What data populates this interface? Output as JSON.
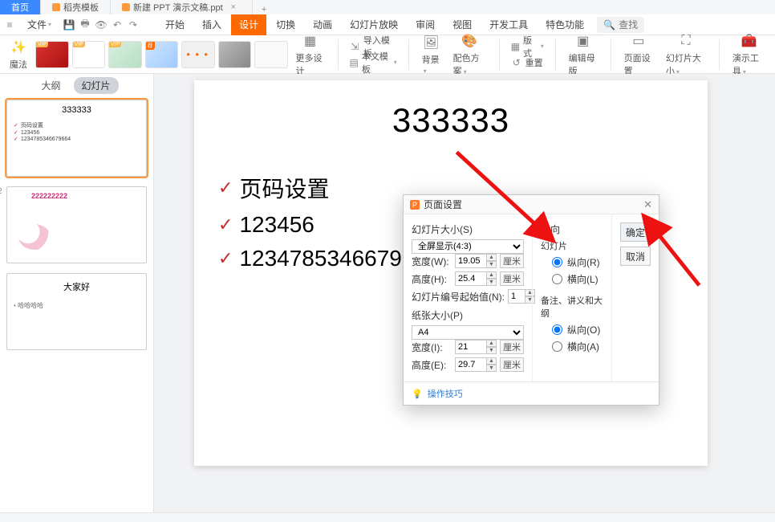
{
  "tabs": {
    "home": "首页",
    "templates": "稻壳模板",
    "doc": "新建 PPT 演示文稿.ppt",
    "add": "+"
  },
  "menu": {
    "file": "文件",
    "items": [
      "开始",
      "插入",
      "设计",
      "切换",
      "动画",
      "幻灯片放映",
      "审阅",
      "视图",
      "开发工具",
      "特色功能"
    ],
    "active_index": 2,
    "search_icon": "🔍",
    "search_label": "查找"
  },
  "ribbon": {
    "vip": "VIP",
    "more_designs": "更多设计",
    "import_tpl": "导入模板",
    "this_tpl": "本文模板",
    "background": "背景",
    "color_scheme": "配色方案",
    "layout": "版式",
    "reset": "重置",
    "edit_master": "编辑母版",
    "page_setup": "页面设置",
    "slide_size": "幻灯片大小",
    "present_tools": "演示工具"
  },
  "side": {
    "outline": "大纲",
    "slides": "幻灯片",
    "s1_title": "333333",
    "s1_b1": "页码设置",
    "s1_b2": "123456",
    "s1_b3": "1234785346679664",
    "s2_cap": "222222222",
    "s3_title": "大家好",
    "s3_b1": "哈哈哈哈"
  },
  "slide": {
    "title": "333333",
    "b1": "页码设置",
    "b2": "123456",
    "b3": "123478534667964"
  },
  "dialog": {
    "title": "页面设置",
    "slide_size_lbl": "幻灯片大小(S)",
    "slide_size_val": "全屏显示(4:3)",
    "width_lbl": "宽度(W):",
    "width_val": "19.05",
    "height_lbl": "高度(H):",
    "height_val": "25.4",
    "number_from_lbl": "幻灯片编号起始值(N):",
    "number_from_val": "1",
    "paper_size_lbl": "纸张大小(P)",
    "paper_size_val": "A4",
    "pwidth_lbl": "宽度(I):",
    "pwidth_val": "21",
    "pheight_lbl": "高度(E):",
    "pheight_val": "29.7",
    "unit": "厘米",
    "orient_lbl": "方向",
    "orient_slides_lbl": "幻灯片",
    "orient_portrait_r": "纵向(R)",
    "orient_landscape_l": "横向(L)",
    "orient_notes_lbl": "备注、讲义和大纲",
    "orient_portrait_o": "纵向(O)",
    "orient_landscape_a": "横向(A)",
    "ok": "确定",
    "cancel": "取消",
    "tips": "操作技巧"
  }
}
